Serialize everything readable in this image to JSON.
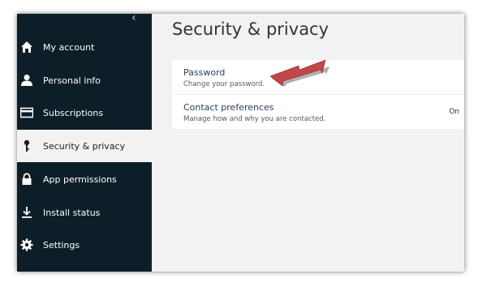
{
  "sidebar": {
    "collapse_glyph": "‹",
    "items": [
      {
        "label": "My account",
        "icon": "home-icon"
      },
      {
        "label": "Personal info",
        "icon": "person-icon"
      },
      {
        "label": "Subscriptions",
        "icon": "card-icon"
      },
      {
        "label": "Security & privacy",
        "icon": "key-icon",
        "active": true
      },
      {
        "label": "App permissions",
        "icon": "lock-icon"
      },
      {
        "label": "Install status",
        "icon": "download-icon"
      },
      {
        "label": "Settings",
        "icon": "gear-icon"
      }
    ]
  },
  "main": {
    "title": "Security & privacy",
    "password": {
      "title": "Password",
      "subtitle": "Change your password."
    },
    "contact": {
      "title": "Contact preferences",
      "subtitle": "Manage how and why you are contacted.",
      "value": "On"
    }
  },
  "colors": {
    "sidebar_bg": "#0e1e28",
    "content_bg": "#f2f2f2",
    "annotation_arrow": "#c0474a"
  }
}
